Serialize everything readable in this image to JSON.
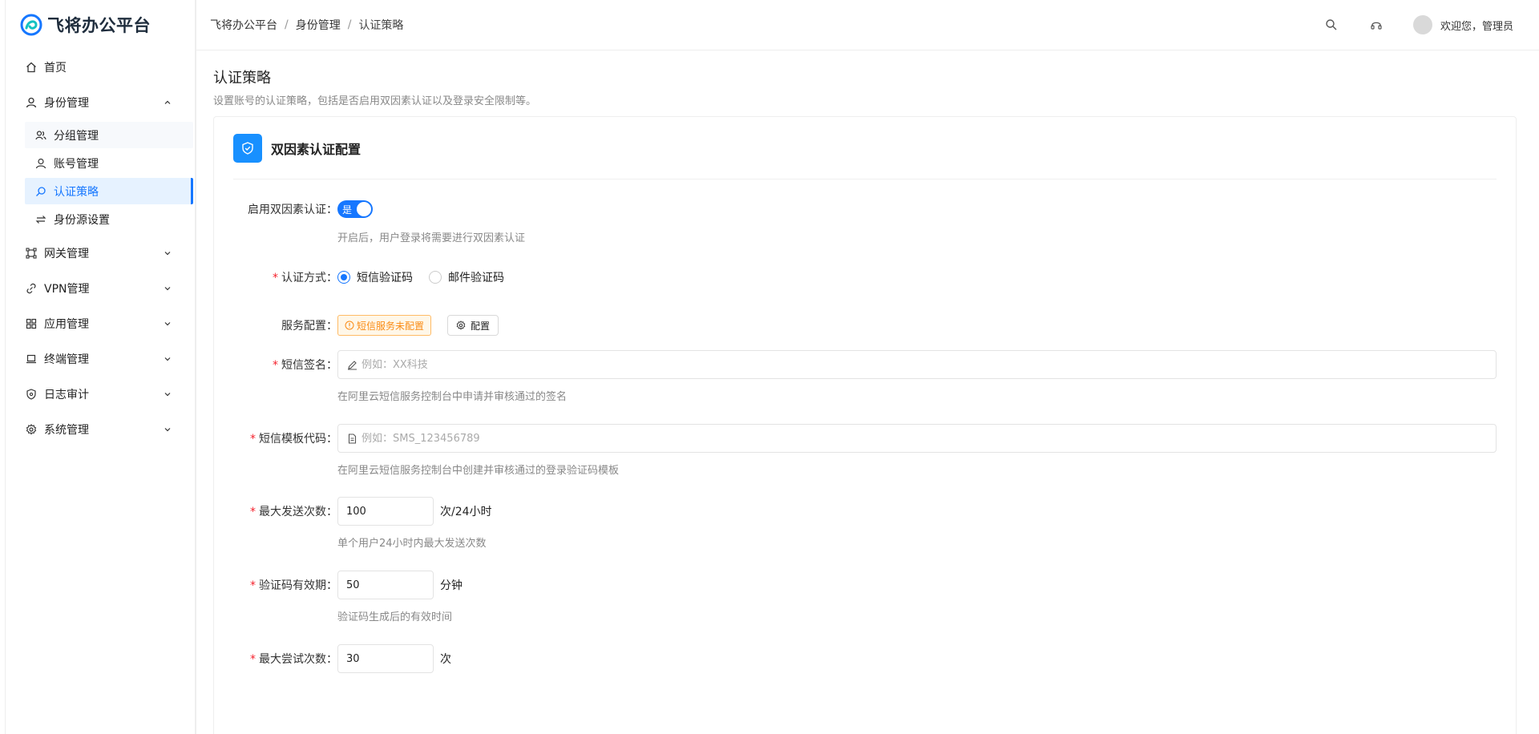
{
  "app": {
    "title": "飞将办公平台",
    "accent": "#1677ff"
  },
  "sidebar": {
    "items": [
      {
        "label": "首页",
        "icon": "home-icon"
      },
      {
        "label": "身份管理",
        "icon": "user-icon",
        "expanded": true,
        "children": [
          {
            "label": "分组管理",
            "icon": "group-icon"
          },
          {
            "label": "账号管理",
            "icon": "account-icon"
          },
          {
            "label": "认证策略",
            "icon": "search-icon",
            "active": true
          },
          {
            "label": "身份源设置",
            "icon": "sync-icon"
          }
        ]
      },
      {
        "label": "网关管理",
        "icon": "gateway-icon"
      },
      {
        "label": "VPN管理",
        "icon": "link-icon"
      },
      {
        "label": "应用管理",
        "icon": "apps-icon"
      },
      {
        "label": "终端管理",
        "icon": "laptop-icon"
      },
      {
        "label": "日志审计",
        "icon": "shield-icon"
      },
      {
        "label": "系统管理",
        "icon": "gear-icon"
      }
    ]
  },
  "topbar": {
    "breadcrumb": [
      "飞将办公平台",
      "身份管理",
      "认证策略"
    ],
    "user_greeting": "欢迎您，管理员"
  },
  "page": {
    "title": "认证策略",
    "description": "设置账号的认证策略，包括是否启用双因素认证以及登录安全限制等。"
  },
  "card": {
    "title": "双因素认证配置",
    "form": {
      "mfa_enabled": {
        "label": "启用双因素认证：",
        "switch_text": "是",
        "help": "开启后，用户登录将需要进行双因素认证"
      },
      "method": {
        "label": "认证方式：",
        "options": [
          "短信验证码",
          "邮件验证码"
        ],
        "selected": "短信验证码"
      },
      "service": {
        "label": "服务配置：",
        "warning": "短信服务未配置",
        "button": "配置"
      },
      "sms_sign": {
        "label": "短信签名：",
        "placeholder": "例如：XX科技",
        "help": "在阿里云短信服务控制台中申请并审核通过的签名"
      },
      "sms_template": {
        "label": "短信模板代码：",
        "placeholder": "例如：SMS_123456789",
        "help": "在阿里云短信服务控制台中创建并审核通过的登录验证码模板"
      },
      "max_send": {
        "label": "最大发送次数：",
        "value": "100",
        "unit": "次/24小时",
        "help": "单个用户24小时内最大发送次数"
      },
      "code_ttl": {
        "label": "验证码有效期：",
        "value": "50",
        "unit": "分钟",
        "help": "验证码生成后的有效时间"
      },
      "max_attempts": {
        "label": "最大尝试次数：",
        "value": "30",
        "unit": "次"
      }
    }
  }
}
